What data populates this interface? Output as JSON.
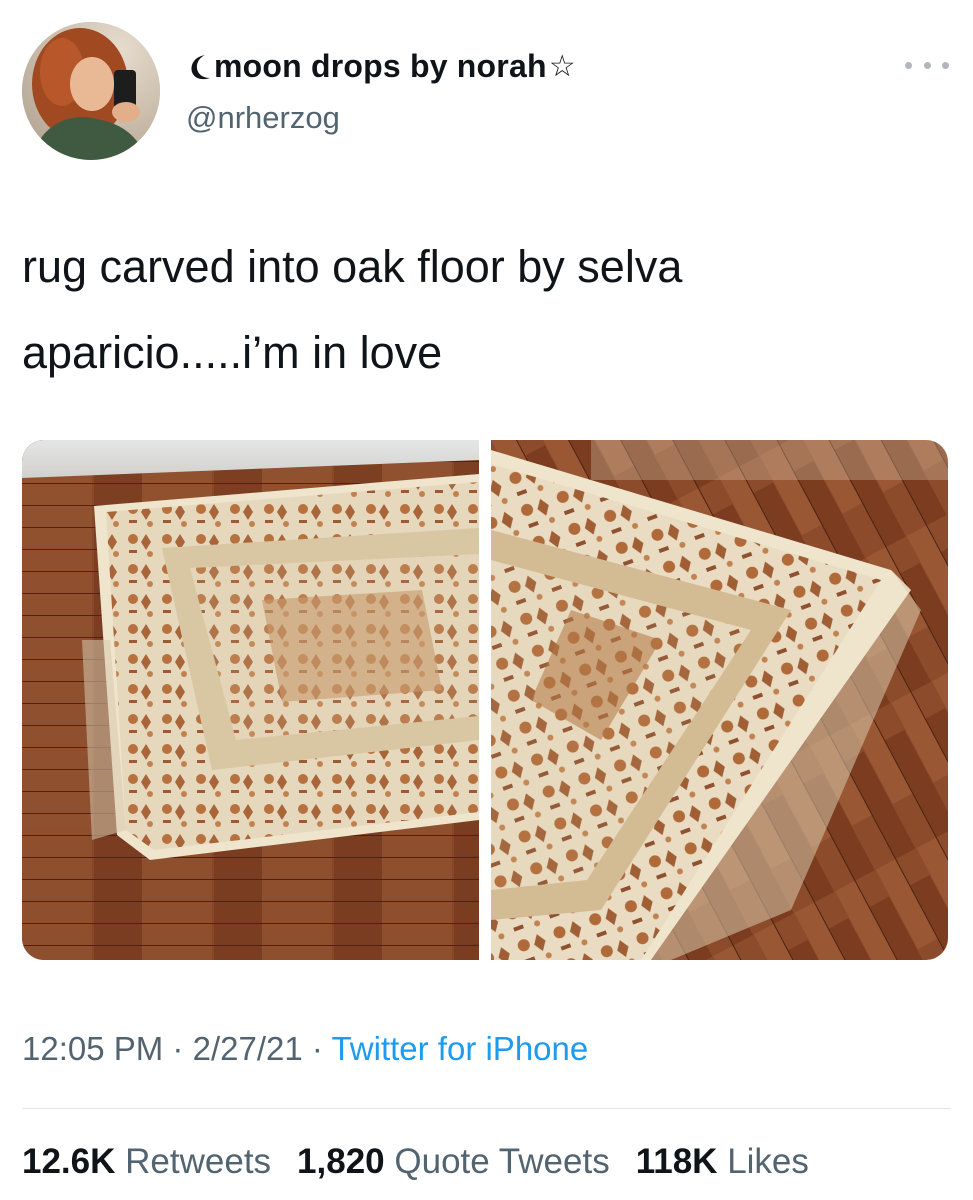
{
  "author": {
    "display_name": "moon drops by norah",
    "handle": "@nrherzog",
    "avatar_icon": "profile-photo",
    "more_icon": "more-dots-icon"
  },
  "tweet": {
    "text_line1": "rug carved into oak floor by selva",
    "text_line2": "aparicio.....i’m in love"
  },
  "meta": {
    "time": "12:05 PM",
    "separator1": "·",
    "date": "2/27/21",
    "separator2": "·",
    "source": "Twitter for iPhone"
  },
  "stats": {
    "retweets_count": "12.6K",
    "retweets_label": "Retweets",
    "quotes_count": "1,820",
    "quotes_label": "Quote Tweets",
    "likes_count": "118K",
    "likes_label": "Likes"
  },
  "colors": {
    "link_blue": "#1d9bf0",
    "secondary_text": "#536471",
    "wood": "#8a4a2a",
    "rug_cream": "#e8dcc4"
  }
}
